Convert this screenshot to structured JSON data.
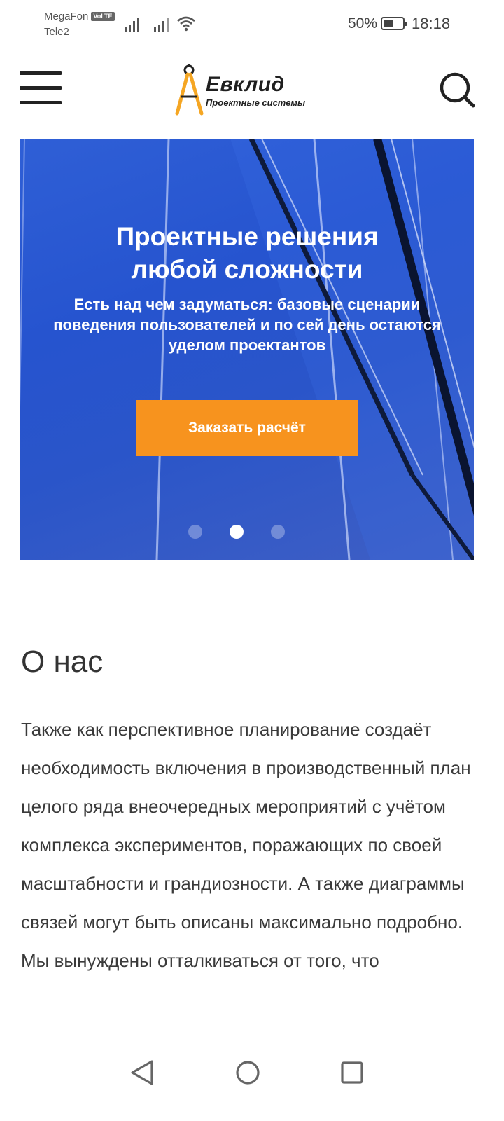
{
  "status_bar": {
    "carrier1": "MegaFon",
    "volte_badge": "VoLTE",
    "carrier2": "Tele2",
    "battery_percent": "50%",
    "battery_level": 0.5,
    "time": "18:18",
    "icons": [
      "signal-icon",
      "signal-icon",
      "wifi-icon",
      "battery-icon"
    ]
  },
  "header": {
    "logo_name": "Евклид",
    "logo_subtitle": "Проектные системы",
    "logo_accent_color": "#f5a623",
    "menu_icon": "hamburger-icon",
    "search_icon": "search-icon"
  },
  "hero": {
    "title_line1": "Проектные решения",
    "title_line2": "любой сложности",
    "subtitle": "Есть над чем задуматься: базовые сценарии поведения пользователей и по сей день остаются уделом проектантов",
    "cta_label": "Заказать расчёт",
    "cta_color": "#f7931e",
    "slide_count": 3,
    "active_slide": 2
  },
  "about": {
    "title": "О нас",
    "text": "Также как перспективное планирование создаёт необходимость включения в производственный план целого ряда внеочередных мероприятий с учётом комплекса экспериментов, поражающих по своей масштабности и грандиозности. А также диаграммы связей могут быть описаны максимально подробно. Мы вынуждены отталкиваться от того, что"
  },
  "nav_bar": {
    "icons": [
      "back-icon",
      "home-icon",
      "recent-apps-icon"
    ]
  }
}
